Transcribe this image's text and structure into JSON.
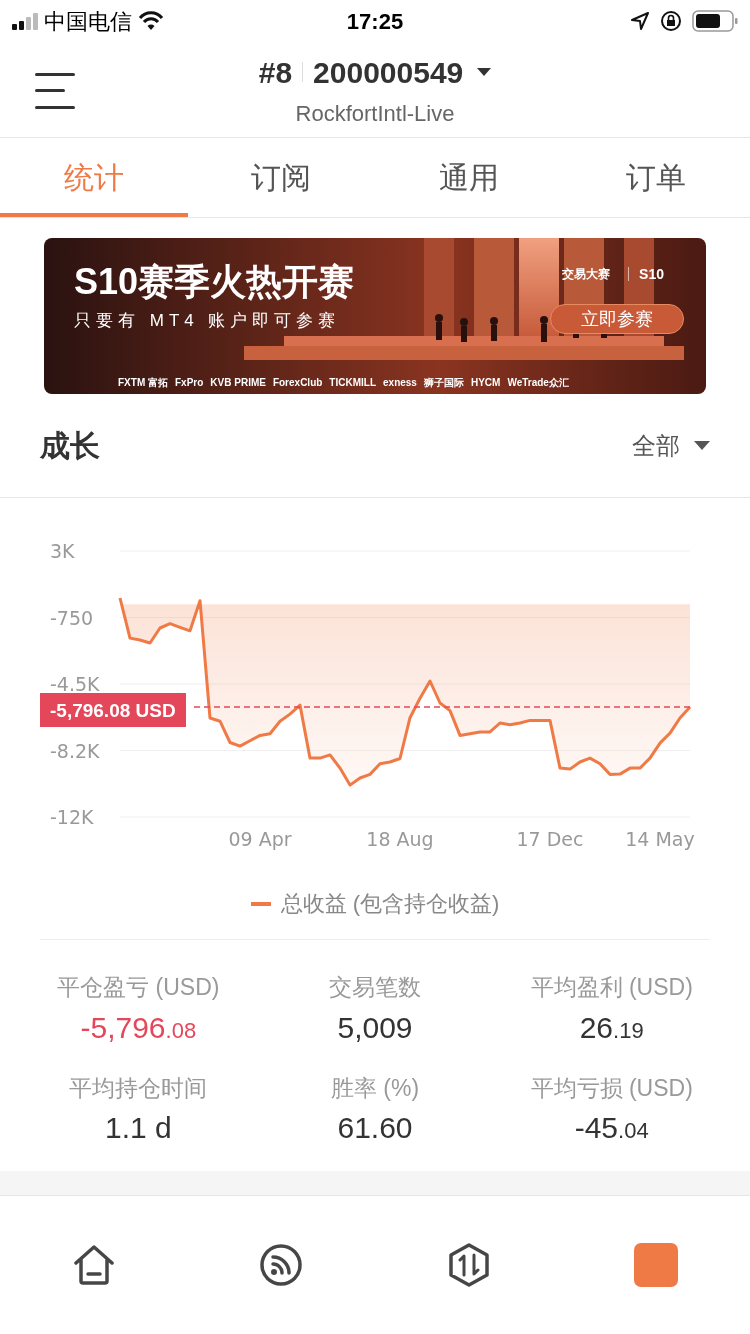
{
  "status_bar": {
    "carrier": "中国电信",
    "time": "17:25"
  },
  "header": {
    "account_index": "#8",
    "account_number": "200000549",
    "server": "RockfortIntl-Live"
  },
  "tabs": [
    {
      "label": "统计",
      "selected": true
    },
    {
      "label": "订阅",
      "selected": false
    },
    {
      "label": "通用",
      "selected": false
    },
    {
      "label": "订单",
      "selected": false
    }
  ],
  "banner": {
    "headline": "S10赛季火热开赛",
    "subline": "只要有 MT4 账户即可参赛",
    "event": "交易大赛",
    "season": "S10",
    "cta": "立即参赛",
    "sponsors": [
      "FXTM 富拓",
      "FxPro",
      "KVB PRIME",
      "ForexClub",
      "TICKMILL",
      "exness",
      "狮子国际",
      "HYCM",
      "WeTrade众汇"
    ]
  },
  "growth": {
    "title": "成长",
    "filter": "全部",
    "chart_data": {
      "type": "area",
      "categories": [
        null,
        null,
        null,
        null,
        null,
        null,
        null,
        null,
        null,
        null,
        null,
        null,
        null,
        null,
        "09 Apr",
        null,
        null,
        null,
        null,
        null,
        null,
        null,
        null,
        null,
        null,
        null,
        null,
        null,
        "18 Aug",
        null,
        null,
        null,
        null,
        null,
        null,
        null,
        null,
        null,
        null,
        null,
        null,
        null,
        null,
        "17 Dec",
        null,
        null,
        null,
        null,
        null,
        null,
        null,
        null,
        null,
        null,
        "14 May",
        null,
        null,
        null
      ],
      "series": [
        {
          "name": "总收益 (包含持仓收益)",
          "color": "#f07a45",
          "values": [
            350,
            -1910,
            -2020,
            -2190,
            -1340,
            -1100,
            -1300,
            -1500,
            200,
            -6420,
            -6600,
            -7800,
            -8000,
            -7700,
            -7400,
            -7300,
            -6600,
            -6200,
            -5690,
            -8680,
            -8680,
            -8500,
            -9240,
            -10200,
            -9800,
            -9600,
            -9000,
            -8900,
            -8700,
            -6400,
            -5300,
            -4330,
            -5570,
            -6000,
            -7400,
            -7300,
            -7200,
            -7200,
            -6700,
            -6800,
            -6700,
            -6550,
            -6550,
            -6550,
            -9240,
            -9300,
            -8900,
            -8680,
            -9000,
            -9600,
            -9580,
            -9240,
            -9240,
            -8680,
            -7830,
            -7270,
            -6420,
            -5800
          ]
        }
      ],
      "ylim": [
        -12000,
        3000
      ],
      "yticks": [
        {
          "value": 3000,
          "label": "3K"
        },
        {
          "value": -750,
          "label": "-750"
        },
        {
          "value": -4500,
          "label": "-4.5K"
        },
        {
          "value": -8250,
          "label": "-8.2K"
        },
        {
          "value": -12000,
          "label": "-12K"
        }
      ],
      "grid": true,
      "ref_lines": [
        {
          "axis": "y",
          "value": -5800,
          "label": "-5,796.08 USD"
        }
      ]
    }
  },
  "stats": [
    {
      "label": "平仓盈亏 (USD)",
      "whole": "-5,796",
      "fraction": ".08",
      "color": "#e5475a"
    },
    {
      "label": "交易笔数",
      "whole": "5,009",
      "color": "#333333"
    },
    {
      "label": "平均盈利 (USD)",
      "whole": "26",
      "fraction": ".19",
      "color": "#333333"
    },
    {
      "label": "平均持仓时间",
      "whole": "1.1 d",
      "color": "#333333"
    },
    {
      "label": "胜率 (%)",
      "whole": "61.60",
      "color": "#333333"
    },
    {
      "label": "平均亏损 (USD)",
      "whole": "-45",
      "fraction": ".04",
      "color": "#333333"
    }
  ],
  "bottom_nav": [
    {
      "kind": "home",
      "selected": false
    },
    {
      "kind": "feed",
      "selected": false
    },
    {
      "kind": "trade",
      "selected": false
    },
    {
      "kind": "profile",
      "selected": true
    }
  ]
}
